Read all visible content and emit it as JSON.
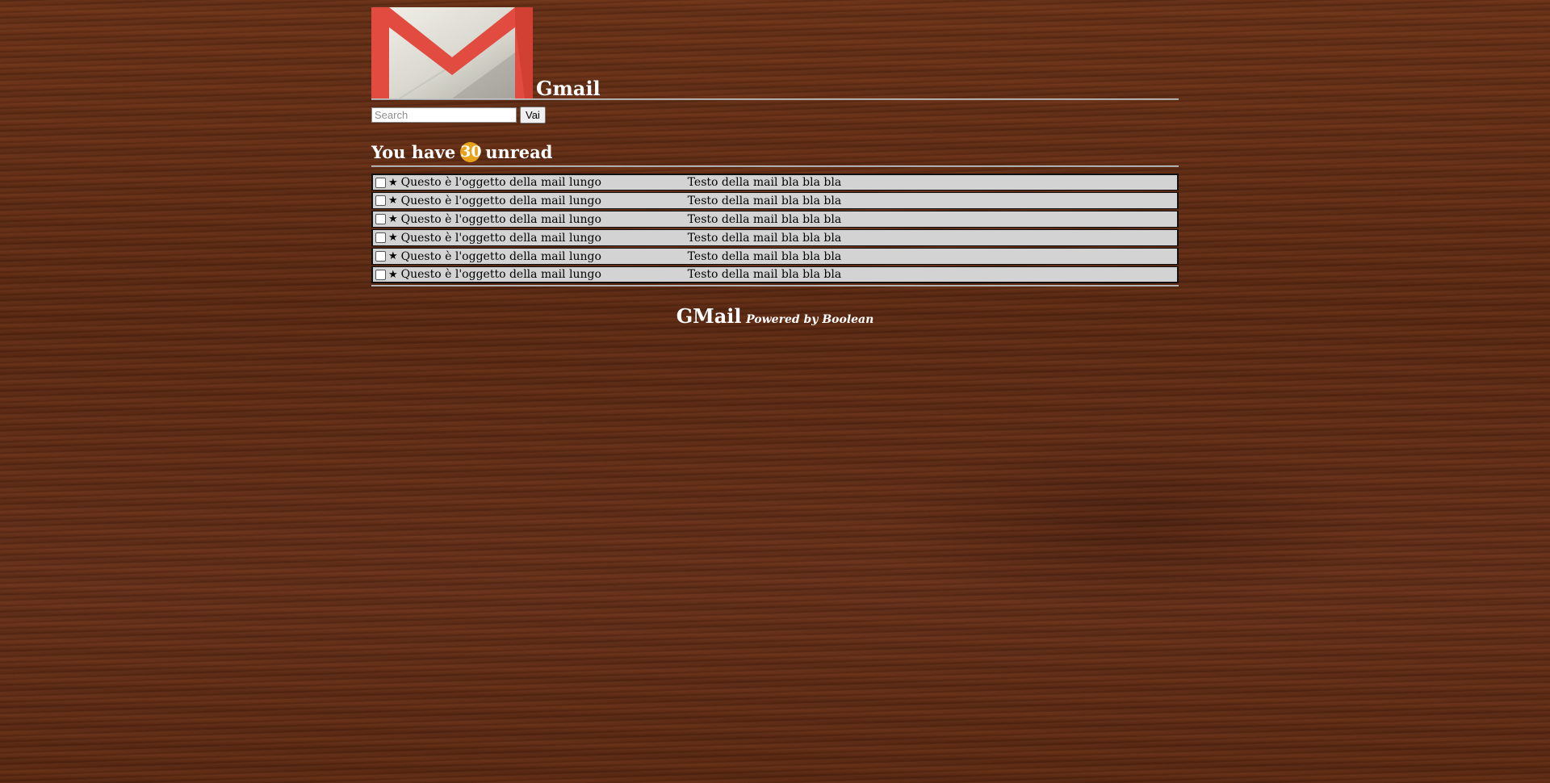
{
  "header": {
    "brand": "Gmail"
  },
  "search": {
    "placeholder": "Search",
    "button_label": "Vai"
  },
  "unread": {
    "prefix": "You have",
    "count": "30",
    "suffix": "unread",
    "badge_color": "#e8a21a"
  },
  "mails": [
    {
      "star": "★",
      "subject": "Questo è l'oggetto della mail lungo",
      "body": "Testo della mail bla bla bla"
    },
    {
      "star": "★",
      "subject": "Questo è l'oggetto della mail lungo",
      "body": "Testo della mail bla bla bla"
    },
    {
      "star": "★",
      "subject": "Questo è l'oggetto della mail lungo",
      "body": "Testo della mail bla bla bla"
    },
    {
      "star": "★",
      "subject": "Questo è l'oggetto della mail lungo",
      "body": "Testo della mail bla bla bla"
    },
    {
      "star": "★",
      "subject": "Questo è l'oggetto della mail lungo",
      "body": "Testo della mail bla bla bla"
    },
    {
      "star": "★",
      "subject": "Questo è l'oggetto della mail lungo",
      "body": "Testo della mail bla bla bla"
    }
  ],
  "footer": {
    "brand": "GMail",
    "powered": "Powered by Boolean"
  },
  "icons": {
    "logo": "gmail-envelope-icon",
    "star": "star-icon",
    "checkbox": "checkbox-icon"
  },
  "colors": {
    "logo_red": "#e24b3f",
    "row_bg": "#d3d3d3"
  }
}
